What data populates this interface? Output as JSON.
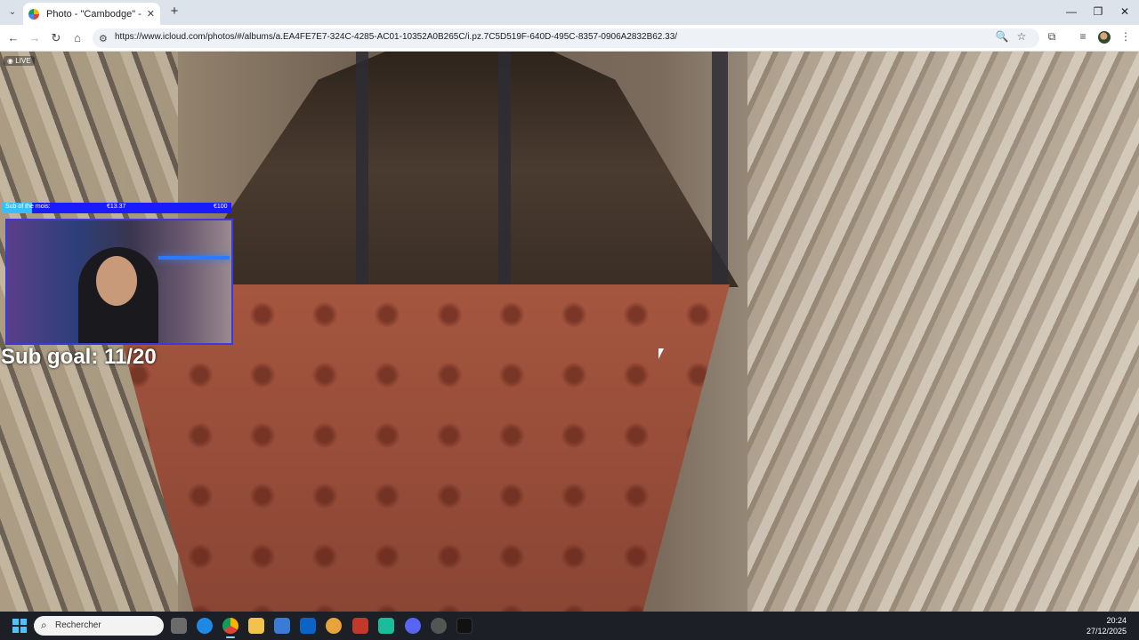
{
  "browser": {
    "tab_title": "Photo - \"Cambodge\" - iCloud P",
    "close": "✕",
    "new_tab": "+",
    "url": "https://www.icloud.com/photos/#/albums/a.EA4FE7E7-324C-4285-AC01-10352A0B265C/i.pz.7C5D519F-640D-495C-8357-0906A2832B62.33/"
  },
  "photo": {
    "live_badge": "◉ LIVE"
  },
  "stream_overlay": {
    "goal_label": "Sub of the mois:",
    "goal_current": "€13.37",
    "goal_target": "€100",
    "goal_progress": 0.1337,
    "sub_goal": "Sub goal: 11/20"
  },
  "taskbar": {
    "search_placeholder": "Rechercher",
    "time": "20:24",
    "date": "27/12/2025"
  },
  "colors": {
    "taskbar_bg": "#1c1f26",
    "goal_bar": "#1a1aff",
    "goal_fill": "#35c0ff"
  }
}
